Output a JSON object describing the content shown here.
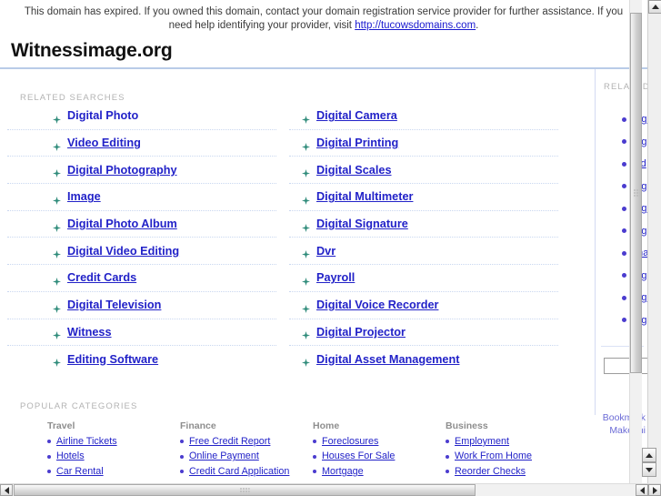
{
  "notice": {
    "text_before": "This domain has expired. If you owned this domain, contact your domain registration service provider for further assistance. If you need help identifying your provider, visit ",
    "link_text": "http://tucowsdomains.com",
    "text_after": "."
  },
  "header": {
    "domain_title": "Witnessimage.org"
  },
  "related_searches": {
    "label": "RELATED SEARCHES",
    "column_left": [
      "Digital Photo",
      "Video Editing",
      "Digital Photography",
      "Image",
      "Digital Photo Album",
      "Digital Video Editing",
      "Credit Cards",
      "Digital Television",
      "Witness",
      "Editing Software"
    ],
    "column_right": [
      "Digital Camera",
      "Digital Printing",
      "Digital Scales",
      "Digital Multimeter",
      "Digital Signature",
      "Dvr",
      "Payroll",
      "Digital Voice Recorder",
      "Digital Projector",
      "Digital Asset Management"
    ]
  },
  "rail": {
    "label": "RELATED",
    "items": [
      "Dig",
      "Dig",
      "Vid",
      "Dig",
      "Dig",
      "Dig",
      "Ima",
      "Dig",
      "Dig",
      "Dig"
    ],
    "search_input_value": "",
    "bookmark_label": "Bookmark",
    "make_home_label": "Make thi"
  },
  "popular_categories": {
    "label": "POPULAR CATEGORIES",
    "columns": [
      {
        "heading": "Travel",
        "items": [
          "Airline Tickets",
          "Hotels",
          "Car Rental"
        ]
      },
      {
        "heading": "Finance",
        "items": [
          "Free Credit Report",
          "Online Payment",
          "Credit Card Application"
        ]
      },
      {
        "heading": "Home",
        "items": [
          "Foreclosures",
          "Houses For Sale",
          "Mortgage"
        ]
      },
      {
        "heading": "Business",
        "items": [
          "Employment",
          "Work From Home",
          "Reorder Checks"
        ]
      }
    ]
  },
  "colors": {
    "link": "#2222c8",
    "bullet_green": "#2e8b7a",
    "bullet_dot": "#4b3ccf",
    "rule": "#b9cbe8",
    "divider": "#d3daf2",
    "label_gray": "#b3b3b3"
  }
}
